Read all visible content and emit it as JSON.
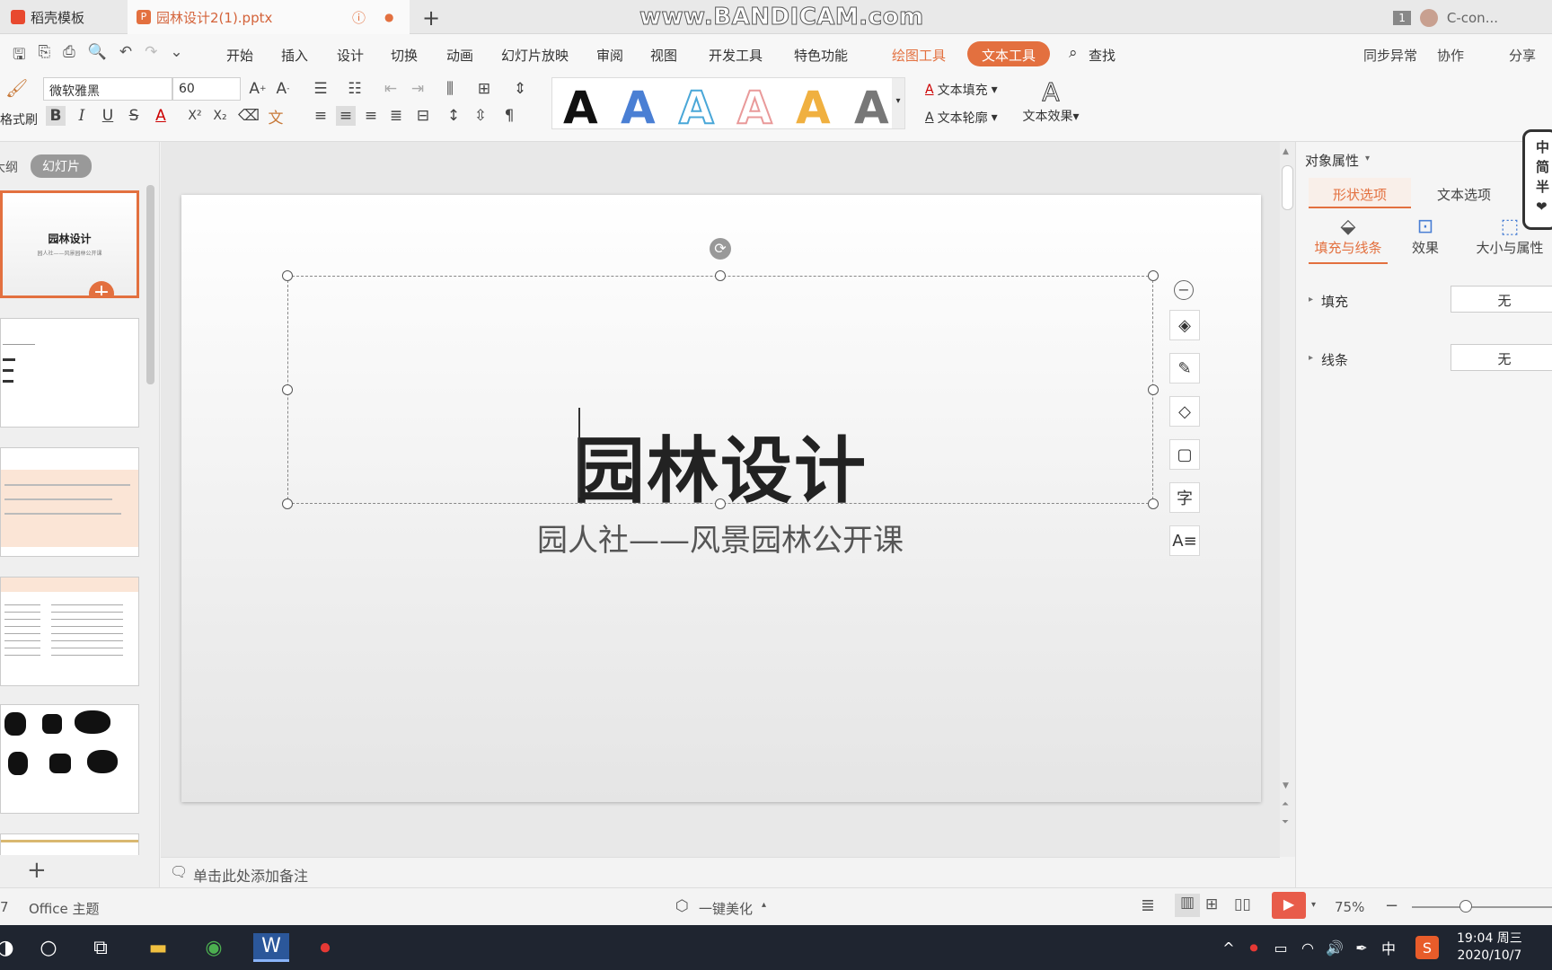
{
  "tabs": [
    {
      "label": "稻壳模板"
    },
    {
      "label": "园林设计2(1).pptx"
    }
  ],
  "watermark": "www.BANDICAM.com",
  "topright": {
    "badge": "1",
    "user": "C-con..."
  },
  "menu": [
    "开始",
    "插入",
    "设计",
    "切换",
    "动画",
    "幻灯片放映",
    "审阅",
    "视图",
    "开发工具",
    "特色功能",
    "绘图工具",
    "文本工具",
    "查找"
  ],
  "menu_right": [
    "同步异常",
    "协作",
    "分享"
  ],
  "ribbon": {
    "font": "微软雅黑",
    "size": "60",
    "format_painter": "格式刷",
    "text_fill": "文本填充",
    "text_outline": "文本轮廓",
    "text_effect": "文本效果",
    "style_letter": "A"
  },
  "left_panel": {
    "outline_tab": "大纲",
    "slides_tab": "幻灯片",
    "thumb1_title": "园林设计",
    "thumb1_sub": "园人社——风景园林公开课"
  },
  "slide": {
    "title": "园林设计",
    "subtitle": "园人社——风景园林公开课"
  },
  "notes": "单击此处添加备注",
  "right_panel": {
    "title": "对象属性",
    "tab_shape": "形状选项",
    "tab_text": "文本选项",
    "sub_fill": "填充与线条",
    "sub_effect": "效果",
    "sub_size": "大小与属性",
    "fill_label": "填充",
    "fill_value": "无",
    "line_label": "线条",
    "line_value": "无",
    "ime": [
      "中",
      "简",
      "半",
      "❤"
    ]
  },
  "status": {
    "slide_num": "7",
    "theme": "Office 主题",
    "beautify": "一键美化",
    "zoom": "75%"
  },
  "taskbar": {
    "time": "19:04 周三",
    "date": "2020/10/7",
    "ime": "中"
  },
  "colors": {
    "accent": "#e3703f",
    "taskbar": "#1f2530"
  }
}
